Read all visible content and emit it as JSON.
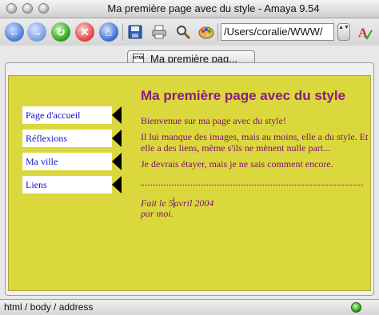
{
  "window": {
    "title": "Ma première page avec du style - Amaya 9.54"
  },
  "toolbar": {
    "url": "/Users/coralie/WWW/",
    "url_stepper": "▲▼",
    "icons": [
      "back-icon",
      "forward-icon",
      "reload-icon",
      "stop-icon",
      "home-icon",
      "save-icon",
      "print-icon",
      "find-icon",
      "style-icon",
      "spellcheck-icon"
    ]
  },
  "tab": {
    "label": "Ma première pag...",
    "doc_badge": "HTML"
  },
  "page": {
    "nav": [
      "Page d'accueil",
      "Réflexions",
      "Ma ville",
      "Liens"
    ],
    "heading": "Ma première page avec du style",
    "paragraphs": [
      "Bienvenue sur ma page avec du style!",
      "Il lui manque des images, mais au moins, elle a du style. Et elle a des liens, même s'ils ne mènent nulle part...",
      "Je devrais étayer, mais je ne sais comment encore."
    ],
    "address": {
      "line1_before": "Fait le 5",
      "line1_after": "avril 2004",
      "line2": "par moi."
    }
  },
  "status": {
    "path": "html / body / address"
  },
  "colors": {
    "page_background": "#dbd83d",
    "text": "#7c1070",
    "heading": "#8a1a84",
    "link": "#1010d0",
    "nav_box": "#ffffff",
    "nav_arrow": "#000000"
  }
}
